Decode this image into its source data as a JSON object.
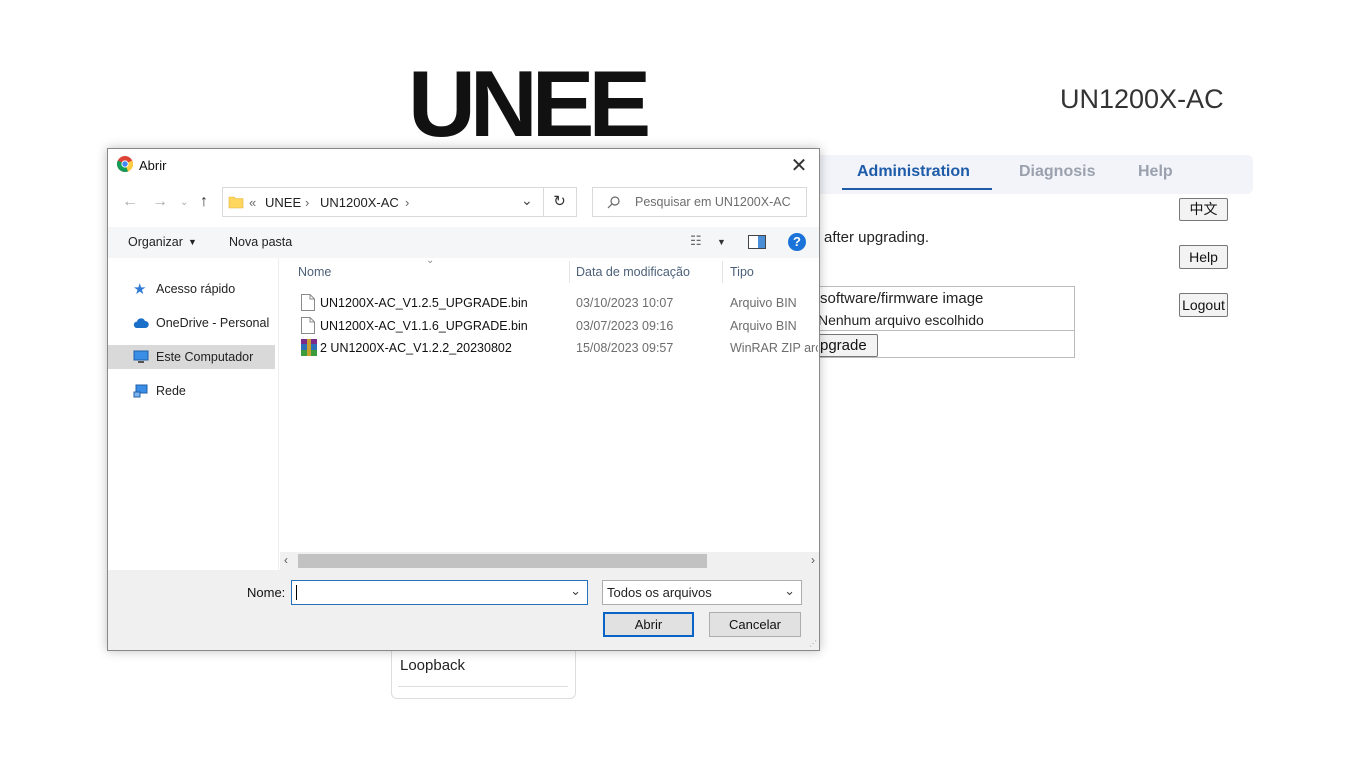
{
  "router": {
    "logo_text": "UNEE",
    "model": "UN1200X-AC",
    "nav": {
      "active": "Administration",
      "items": [
        "Diagnosis",
        "Help"
      ]
    },
    "lang_button": "中文",
    "help_button": "Help",
    "logout_button": "Logout",
    "note_text": "after upgrading.",
    "firmware_label": "software/firmware image",
    "no_file_text": "Nenhum arquivo escolhido",
    "upgrade_button": "pgrade",
    "sidebar_item": "Loopback"
  },
  "dialog": {
    "title": "Abrir",
    "close_glyph": "✕",
    "breadcrumb": [
      "UNEE",
      "UN1200X-AC"
    ],
    "search_placeholder": "Pesquisar em UN1200X-AC",
    "toolbar": {
      "organize": "Organizar",
      "new_folder": "Nova pasta"
    },
    "nav_pane": [
      {
        "label": "Acesso rápido",
        "icon": "star-icon"
      },
      {
        "label": "OneDrive - Personal",
        "icon": "cloud-icon"
      },
      {
        "label": "Este Computador",
        "icon": "computer-icon",
        "selected": true
      },
      {
        "label": "Rede",
        "icon": "network-icon"
      }
    ],
    "columns": {
      "name": "Nome",
      "date": "Data de modificação",
      "type": "Tipo"
    },
    "files": [
      {
        "name": "UN1200X-AC_V1.2.5_UPGRADE.bin",
        "date": "03/10/2023 10:07",
        "type": "Arquivo BIN",
        "icon": "file-icon"
      },
      {
        "name": "UN1200X-AC_V1.1.6_UPGRADE.bin",
        "date": "03/07/2023 09:16",
        "type": "Arquivo BIN",
        "icon": "file-icon"
      },
      {
        "name": "2 UN1200X-AC_V1.2.2_20230802",
        "date": "15/08/2023 09:57",
        "type": "WinRAR ZIP arc",
        "icon": "winrar-icon"
      }
    ],
    "name_label": "Nome:",
    "name_value": "",
    "filter": "Todos os arquivos",
    "open_button": "Abrir",
    "cancel_button": "Cancelar"
  },
  "colors": {
    "accent": "#1e5ba8",
    "nav_inactive": "#9aa1ad",
    "selected_row": "#d9d9d9"
  }
}
